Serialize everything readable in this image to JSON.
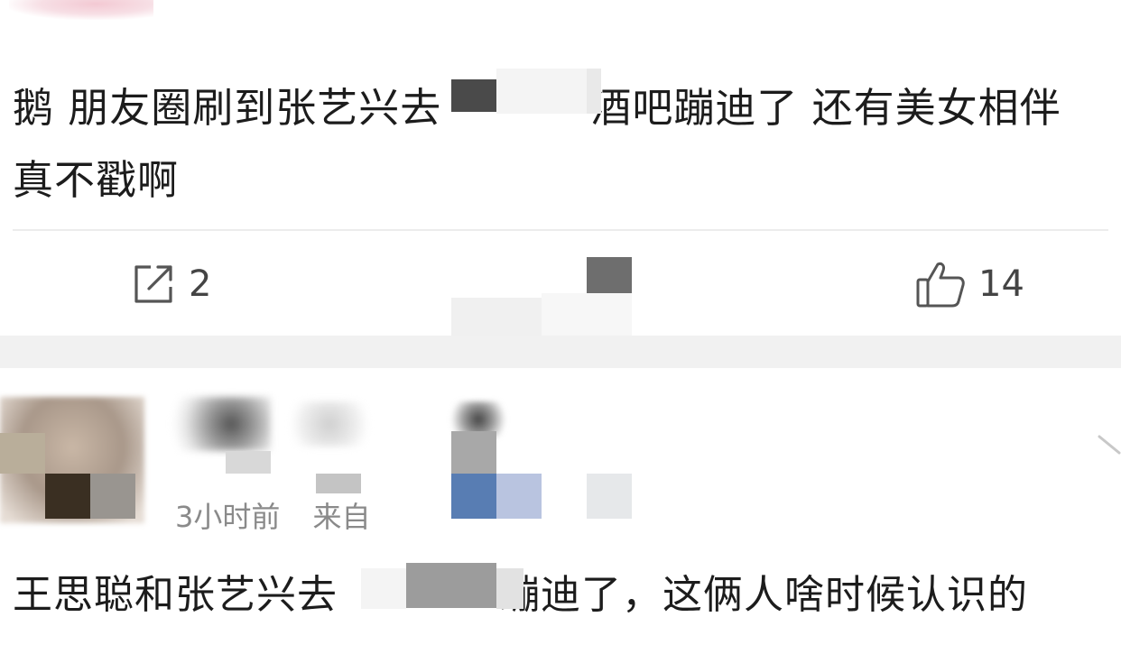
{
  "post": {
    "text_before_blur": "鹅 朋友圈刷到张艺兴去",
    "text_after_blur": "酒吧蹦迪了 还有美女相伴 真不戳啊"
  },
  "actions": {
    "repost_count": "2",
    "like_count": "14"
  },
  "comment": {
    "meta_time": "3小时前",
    "meta_source": "来自",
    "text_before_blur": "王思聪和张艺兴去",
    "text_after_blur": "蹦迪了，这俩人啥时候认识的"
  },
  "icons": {
    "repost": "repost-icon",
    "like": "thumbs-up-icon",
    "more": "chevron-down-icon"
  },
  "colors": {
    "divider": "#ececec",
    "band": "#f1f1f1",
    "text": "#1c1c1c",
    "meta": "#8a8a8a"
  }
}
